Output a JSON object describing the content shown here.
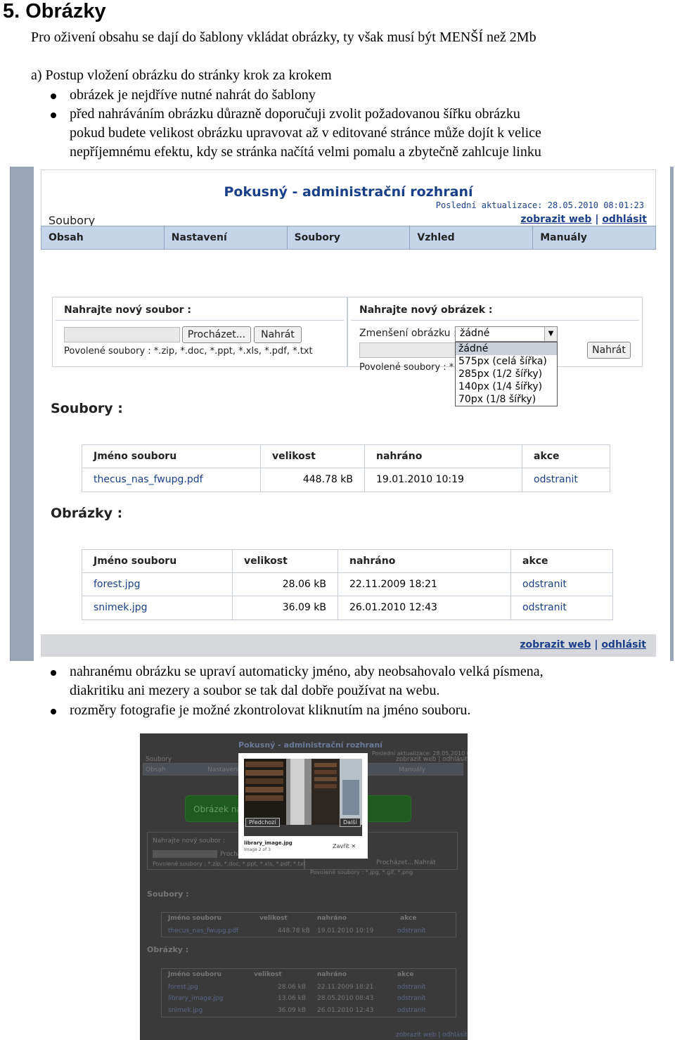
{
  "heading": "5. Obrázky",
  "intro": "Pro oživení obsahu se dají do šablony vkládat obrázky, ty však musí být MENŠÍ než 2Mb",
  "section_a": "a)  Postup vložení obrázku do stránky krok za krokem",
  "bullets_top": [
    "obrázek je nejdříve nutné nahrát do šablony",
    "před nahráváním obrázku důrazně doporučuji zvolit požadovanou šířku obrázku"
  ],
  "continuation": [
    "pokud budete velikost obrázku upravovat až v editované stránce může dojít k velice",
    "nepříjemnému efektu, kdy se stránka načítá velmi pomalu a zbytečně zahlcuje linku"
  ],
  "screenshot1": {
    "title": "Pokusný - administrační rozhraní",
    "last_update": "Poslední aktualizace: 28.05.2010 08:01:23",
    "section": "Soubory",
    "link_web": "zobrazit web",
    "separator": "|",
    "link_logout": "odhlásit",
    "nav": [
      "Obsah",
      "Nastavení",
      "Soubory",
      "Vzhled",
      "Manuály"
    ],
    "upload_file": {
      "title": "Nahrajte nový soubor :",
      "browse": "Procházet...",
      "upload": "Nahrát",
      "allowed": "Povolené soubory : *.zip, *.doc, *.ppt, *.xls, *.pdf, *.txt"
    },
    "upload_image": {
      "title": "Nahrajte nový obrázek :",
      "resize_label": "Zmenšení obrázku :",
      "selected": "žádné",
      "options": [
        "žádné",
        "575px (celá šířka)",
        "285px (1/2 šířky)",
        "140px (1/4 šířky)",
        "70px (1/8 šířky)"
      ],
      "upload": "Nahrát",
      "allowed": "Povolené soubory : *"
    },
    "files_heading": "Soubory :",
    "files_columns": [
      "Jméno souboru",
      "velikost",
      "nahráno",
      "akce"
    ],
    "files_rows": [
      {
        "name": "thecus_nas_fwupg.pdf",
        "size": "448.78 kB",
        "date": "19.01.2010 10:19",
        "action": "odstranit"
      }
    ],
    "images_heading": "Obrázky :",
    "images_columns": [
      "Jméno souboru",
      "velikost",
      "nahráno",
      "akce"
    ],
    "images_rows": [
      {
        "name": "forest.jpg",
        "size": "28.06 kB",
        "date": "22.11.2009 18:21",
        "action": "odstranit"
      },
      {
        "name": "snimek.jpg",
        "size": "36.09 kB",
        "date": "26.01.2010 12:43",
        "action": "odstranit"
      }
    ],
    "footer_web": "zobrazit web",
    "footer_sep": "|",
    "footer_logout": "odhlásit"
  },
  "bullets_bottom": [
    "nahranému obrázku se upraví automaticky jméno, aby neobsahovalo velká písmena,",
    "rozměry fotografie je možné zkontrolovat kliknutím na jméno souboru."
  ],
  "bullets_bottom_cont": "diakritiku ani mezery a soubor se tak dal dobře používat na webu.",
  "screenshot2": {
    "title": "Pokusný - administrační rozhraní",
    "last_update": "Poslední aktualizace: 28.05.2010 08:43:19",
    "section": "Soubory",
    "links": "zobrazit web | odhlásit",
    "nav": [
      "Obsah",
      "Nastavení",
      "Manuály"
    ],
    "green_notice": "Obrázek na",
    "upload_title": "Nahrajte nový soubor :",
    "browse": "Procházet...",
    "upload": "Nahrát",
    "allowed_files": "Povolené soubory : *.zip, *.doc, *.ppt, *.xls, *.pdf, *.txt",
    "allowed_images": "Povolené soubory : *.jpg, *.gif, *.png",
    "files_heading": "Soubory :",
    "images_heading": "Obrázky :",
    "columns": [
      "Jméno souboru",
      "velikost",
      "nahráno",
      "akce"
    ],
    "files_rows": [
      {
        "name": "thecus_nas_fwupg.pdf",
        "size": "448.78 kB",
        "date": "19.01.2010 10:19",
        "action": "odstranit"
      }
    ],
    "images_rows": [
      {
        "name": "forest.jpg",
        "size": "28.06 kB",
        "date": "22.11.2009 18:21",
        "action": "odstranit"
      },
      {
        "name": "library_image.jpg",
        "size": "13.06 kB",
        "date": "28.05.2010 08:43",
        "action": "odstranit"
      },
      {
        "name": "snimek.jpg",
        "size": "36.09 kB",
        "date": "26.01.2010 12:43",
        "action": "odstranit"
      }
    ],
    "footer_links": "zobrazit web | odhlásit",
    "lightbox": {
      "prev": "Předchozí",
      "next": "Další",
      "filename": "library_image.jpg",
      "counter": "Image 2 of 3",
      "close": "Zavřít"
    }
  }
}
